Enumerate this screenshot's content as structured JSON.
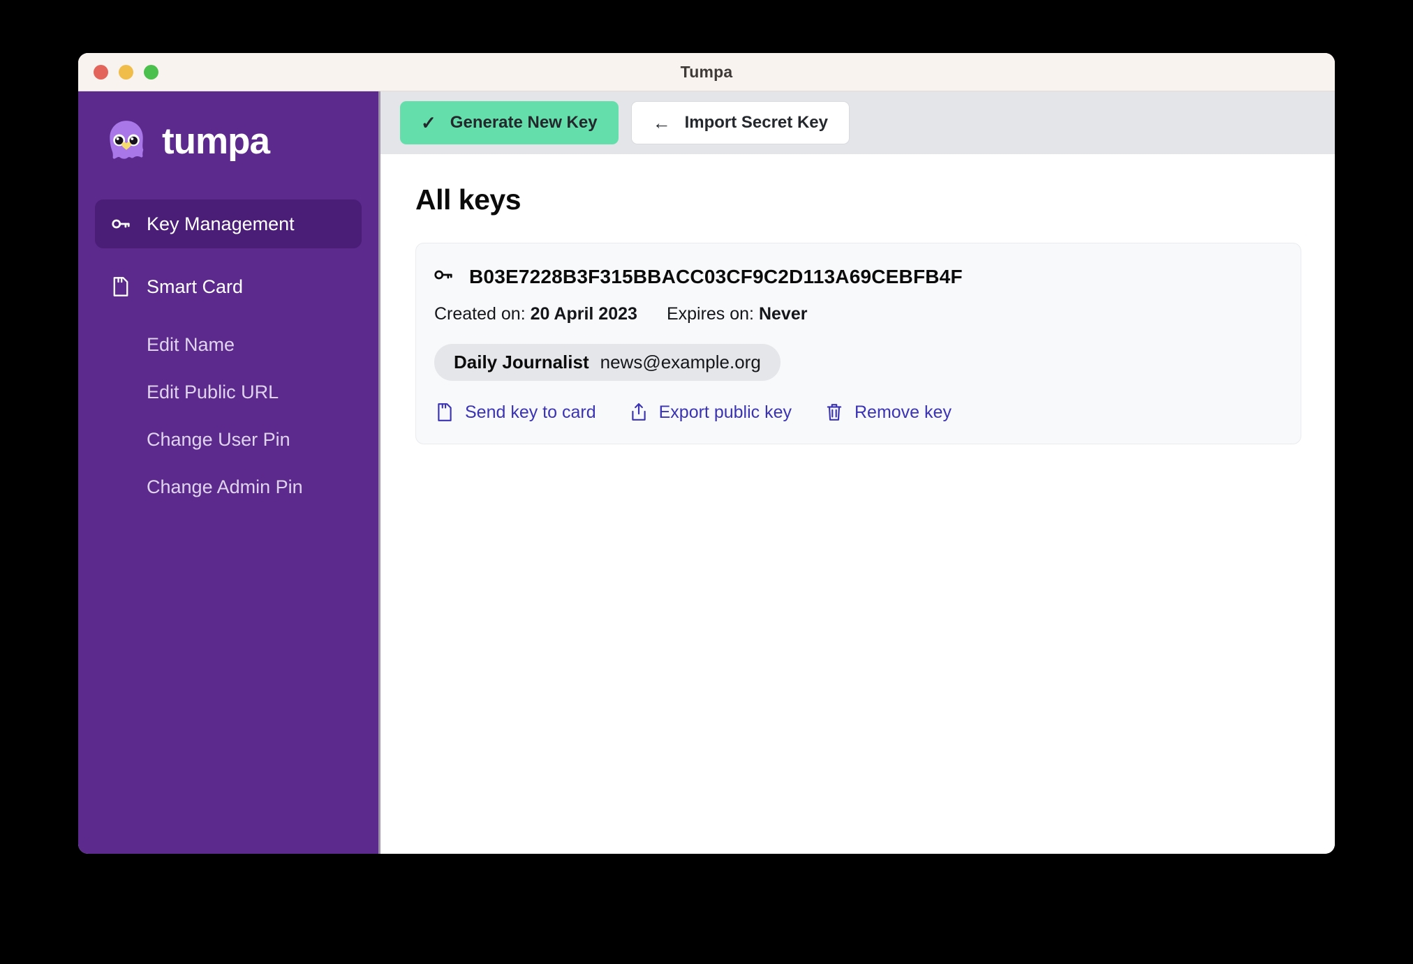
{
  "window": {
    "title": "Tumpa",
    "traffic_lights": [
      {
        "name": "close",
        "color": "#e2645a"
      },
      {
        "name": "minimize",
        "color": "#f0bd4a"
      },
      {
        "name": "zoom",
        "color": "#4cc04c"
      }
    ]
  },
  "sidebar": {
    "brand": "tumpa",
    "brand_icon": "bird-logo-icon",
    "background": "#5b2a8c",
    "active_background": "#4a1d77",
    "items": [
      {
        "label": "Key Management",
        "icon": "key-icon",
        "active": true
      },
      {
        "label": "Smart Card",
        "icon": "smart-card-icon",
        "active": false
      }
    ],
    "sub_items": [
      {
        "label": "Edit Name"
      },
      {
        "label": "Edit Public URL"
      },
      {
        "label": "Change User Pin"
      },
      {
        "label": "Change Admin Pin"
      }
    ]
  },
  "toolbar": {
    "generate_label": "Generate New Key",
    "generate_icon": "check-icon",
    "generate_color": "#64dfab",
    "import_label": "Import Secret Key",
    "import_icon": "arrow-left-icon"
  },
  "main": {
    "page_title": "All keys",
    "key": {
      "icon": "key-icon",
      "fingerprint": "B03E7228B3F315BBACC03CF9C2D113A69CEBFB4F",
      "created_label": "Created on:",
      "created_value": "20 April 2023",
      "expires_label": "Expires on:",
      "expires_value": "Never",
      "uid_name": "Daily Journalist",
      "uid_email": "news@example.org",
      "actions": [
        {
          "label": "Send key to card",
          "icon": "smart-card-icon"
        },
        {
          "label": "Export public key",
          "icon": "share-upload-icon"
        },
        {
          "label": "Remove key",
          "icon": "trash-icon"
        }
      ],
      "link_color": "#3b33b5"
    }
  }
}
